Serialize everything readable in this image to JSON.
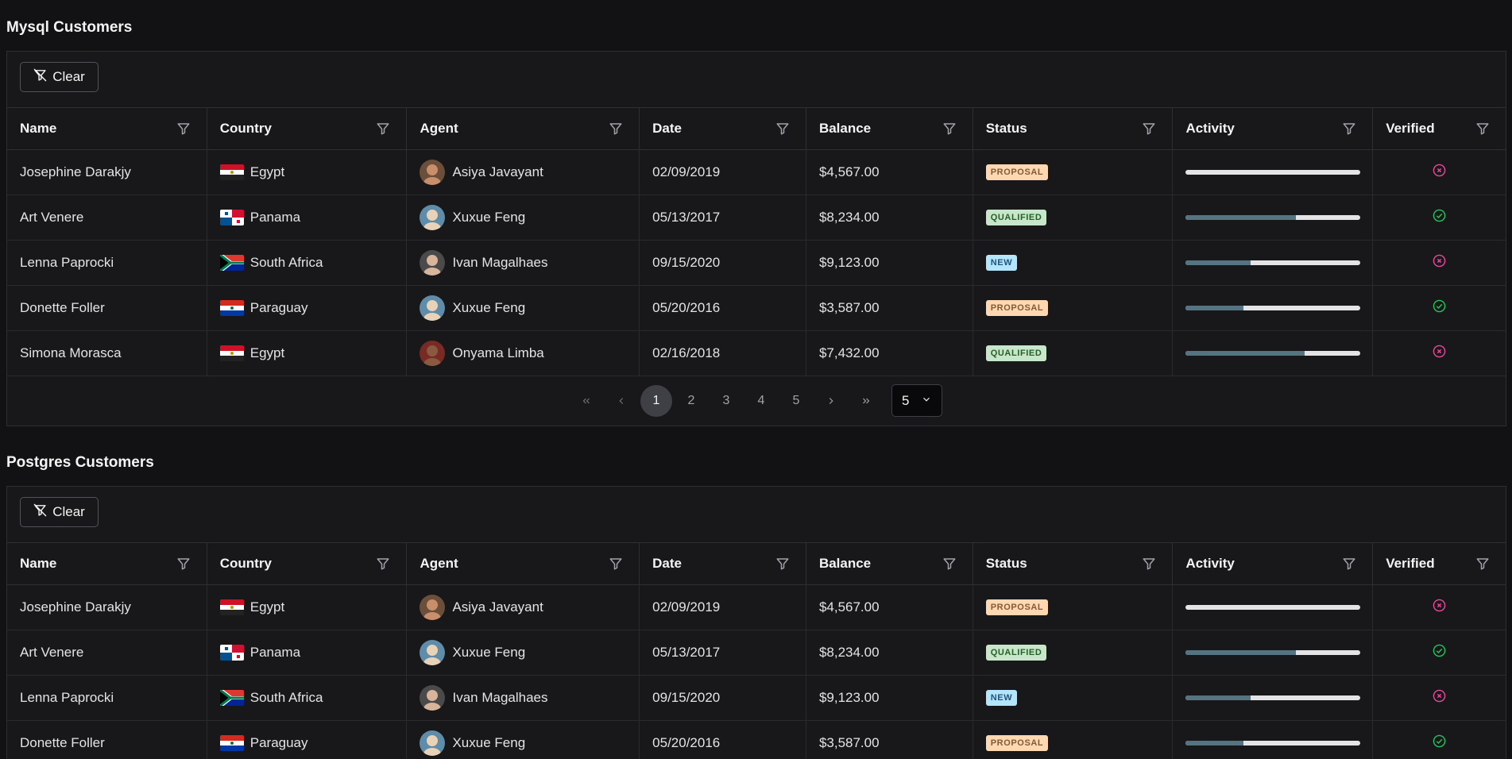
{
  "tables": [
    {
      "title": "Mysql Customers",
      "clear_label": "Clear",
      "columns": [
        "Name",
        "Country",
        "Agent",
        "Date",
        "Balance",
        "Status",
        "Activity",
        "Verified"
      ],
      "rows": [
        {
          "name": "Josephine Darakjy",
          "country": "Egypt",
          "flag": "egypt",
          "agent": "Asiya Javayant",
          "date": "02/09/2019",
          "balance": "$4,567.00",
          "status": "PROPOSAL",
          "activity": 0,
          "verified": false
        },
        {
          "name": "Art Venere",
          "country": "Panama",
          "flag": "panama",
          "agent": "Xuxue Feng",
          "date": "05/13/2017",
          "balance": "$8,234.00",
          "status": "QUALIFIED",
          "activity": 63,
          "verified": true
        },
        {
          "name": "Lenna Paprocki",
          "country": "South Africa",
          "flag": "sa",
          "agent": "Ivan Magalhaes",
          "date": "09/15/2020",
          "balance": "$9,123.00",
          "status": "NEW",
          "activity": 37,
          "verified": false
        },
        {
          "name": "Donette Foller",
          "country": "Paraguay",
          "flag": "paraguay",
          "agent": "Xuxue Feng",
          "date": "05/20/2016",
          "balance": "$3,587.00",
          "status": "PROPOSAL",
          "activity": 33,
          "verified": true
        },
        {
          "name": "Simona Morasca",
          "country": "Egypt",
          "flag": "egypt",
          "agent": "Onyama Limba",
          "date": "02/16/2018",
          "balance": "$7,432.00",
          "status": "QUALIFIED",
          "activity": 68,
          "verified": false
        }
      ],
      "pagination": {
        "pages": [
          "1",
          "2",
          "3",
          "4",
          "5"
        ],
        "current": "1",
        "rows_per_page": "5"
      }
    },
    {
      "title": "Postgres Customers",
      "clear_label": "Clear",
      "columns": [
        "Name",
        "Country",
        "Agent",
        "Date",
        "Balance",
        "Status",
        "Activity",
        "Verified"
      ],
      "rows": [
        {
          "name": "Josephine Darakjy",
          "country": "Egypt",
          "flag": "egypt",
          "agent": "Asiya Javayant",
          "date": "02/09/2019",
          "balance": "$4,567.00",
          "status": "PROPOSAL",
          "activity": 0,
          "verified": false
        },
        {
          "name": "Art Venere",
          "country": "Panama",
          "flag": "panama",
          "agent": "Xuxue Feng",
          "date": "05/13/2017",
          "balance": "$8,234.00",
          "status": "QUALIFIED",
          "activity": 63,
          "verified": true
        },
        {
          "name": "Lenna Paprocki",
          "country": "South Africa",
          "flag": "sa",
          "agent": "Ivan Magalhaes",
          "date": "09/15/2020",
          "balance": "$9,123.00",
          "status": "NEW",
          "activity": 37,
          "verified": false
        },
        {
          "name": "Donette Foller",
          "country": "Paraguay",
          "flag": "paraguay",
          "agent": "Xuxue Feng",
          "date": "05/20/2016",
          "balance": "$3,587.00",
          "status": "PROPOSAL",
          "activity": 33,
          "verified": true
        }
      ]
    }
  ],
  "colors": {
    "background": "#121214",
    "card": "#18181b",
    "activity_fill": "#547481",
    "verified_true": "#22c55e",
    "verified_false": "#ec4899"
  }
}
